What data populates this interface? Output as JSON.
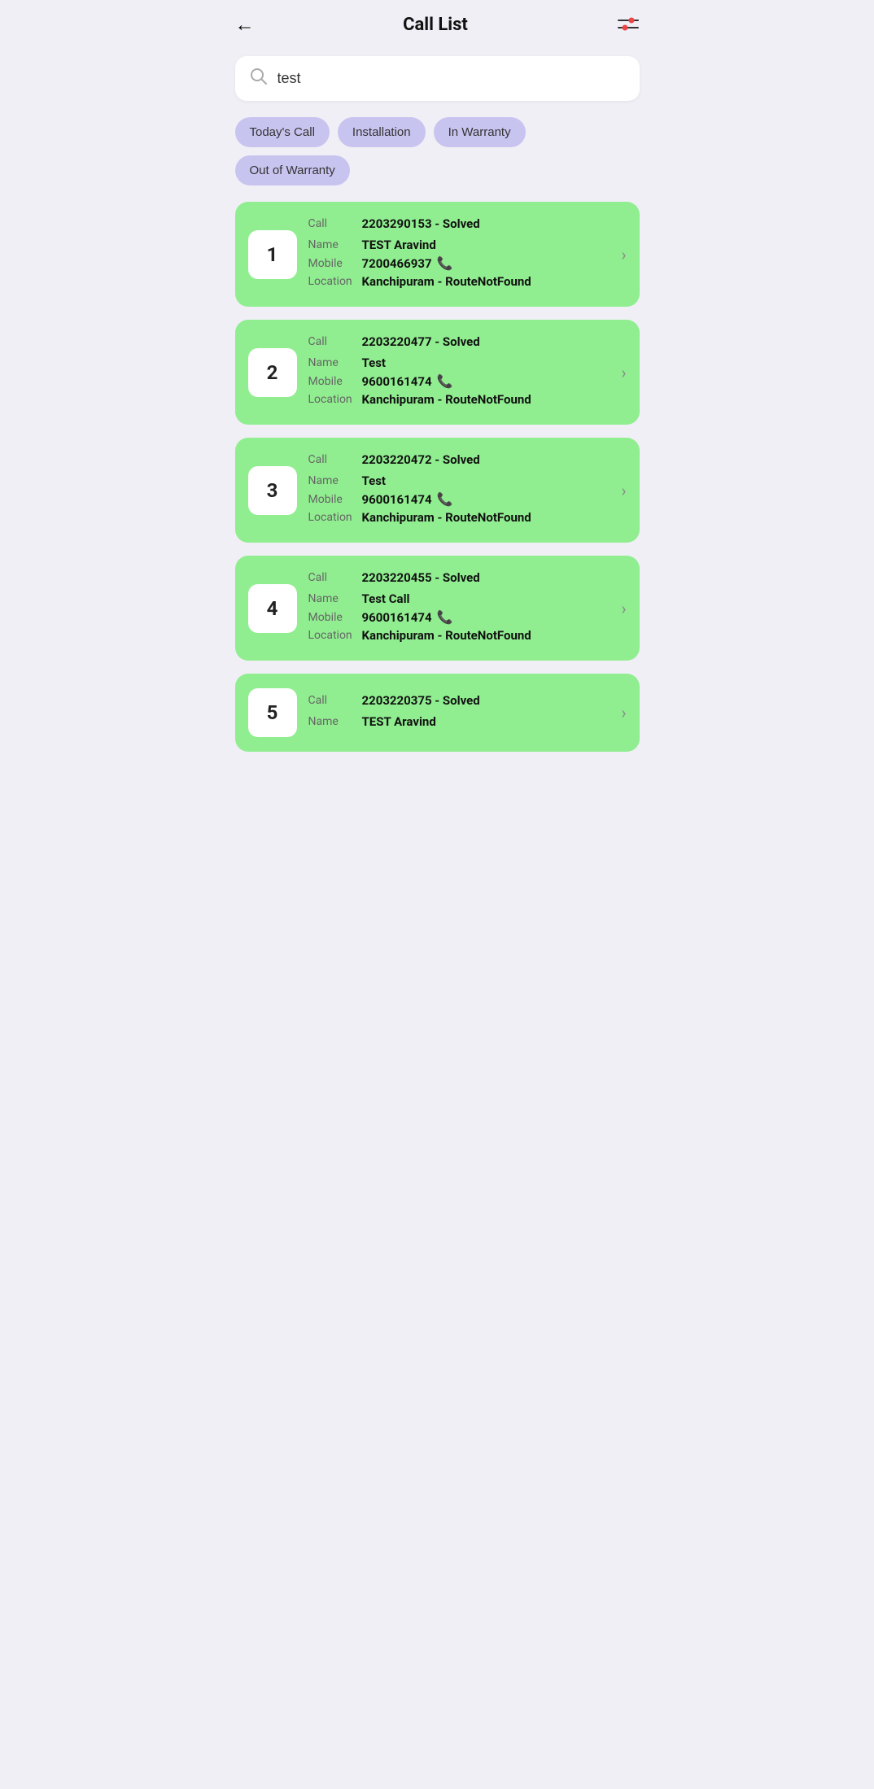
{
  "header": {
    "title": "Call List",
    "back_icon": "←",
    "filter_icon": "filter"
  },
  "search": {
    "placeholder": "Search",
    "value": "test"
  },
  "filter_tabs": [
    {
      "id": "todays-call",
      "label": "Today's Call"
    },
    {
      "id": "installation",
      "label": "Installation"
    },
    {
      "id": "in-warranty",
      "label": "In Warranty"
    },
    {
      "id": "out-of-warranty",
      "label": "Out of Warranty"
    }
  ],
  "calls": [
    {
      "number": "1",
      "call_id": "2203290153 - Solved",
      "name": "TEST Aravind",
      "mobile": "7200466937",
      "location": "Kanchipuram - RouteNotFound"
    },
    {
      "number": "2",
      "call_id": "2203220477 - Solved",
      "name": "Test",
      "mobile": "9600161474",
      "location": "Kanchipuram - RouteNotFound"
    },
    {
      "number": "3",
      "call_id": "2203220472 - Solved",
      "name": "Test",
      "mobile": "9600161474",
      "location": "Kanchipuram - RouteNotFound"
    },
    {
      "number": "4",
      "call_id": "2203220455 - Solved",
      "name": "Test Call",
      "mobile": "9600161474",
      "location": "Kanchipuram - RouteNotFound"
    },
    {
      "number": "5",
      "call_id": "2203220375 - Solved",
      "name": "TEST Aravind",
      "mobile": "",
      "location": ""
    }
  ],
  "labels": {
    "call": "Call",
    "name": "Name",
    "mobile": "Mobile",
    "location": "Location"
  }
}
